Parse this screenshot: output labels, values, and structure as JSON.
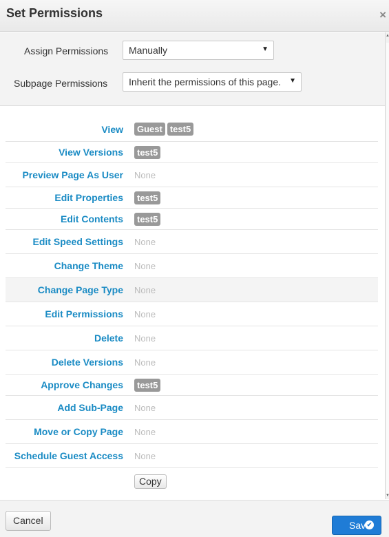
{
  "dialog": {
    "title": "Set Permissions",
    "close_icon": "×"
  },
  "settings": {
    "assign_label": "Assign Permissions",
    "assign_value": "Manually",
    "subpage_label": "Subpage Permissions",
    "subpage_value": "Inherit the permissions of this page."
  },
  "permissions": [
    {
      "label": "View",
      "values": [
        "Guest",
        "test5"
      ]
    },
    {
      "label": "View Versions",
      "values": [
        "test5"
      ]
    },
    {
      "label": "Preview Page As User",
      "values": []
    },
    {
      "label": "Edit Properties",
      "values": [
        "test5"
      ]
    },
    {
      "label": "Edit Contents",
      "values": [
        "test5"
      ]
    },
    {
      "label": "Edit Speed Settings",
      "values": []
    },
    {
      "label": "Change Theme",
      "values": []
    },
    {
      "label": "Change Page Type",
      "values": []
    },
    {
      "label": "Edit Permissions",
      "values": []
    },
    {
      "label": "Delete",
      "values": []
    },
    {
      "label": "Delete Versions",
      "values": []
    },
    {
      "label": "Approve Changes",
      "values": [
        "test5"
      ]
    },
    {
      "label": "Add Sub-Page",
      "values": []
    },
    {
      "label": "Move or Copy Page",
      "values": []
    },
    {
      "label": "Schedule Guest Access",
      "values": []
    }
  ],
  "none_text": "None",
  "buttons": {
    "copy": "Copy",
    "cancel": "Cancel",
    "save": "Save"
  }
}
